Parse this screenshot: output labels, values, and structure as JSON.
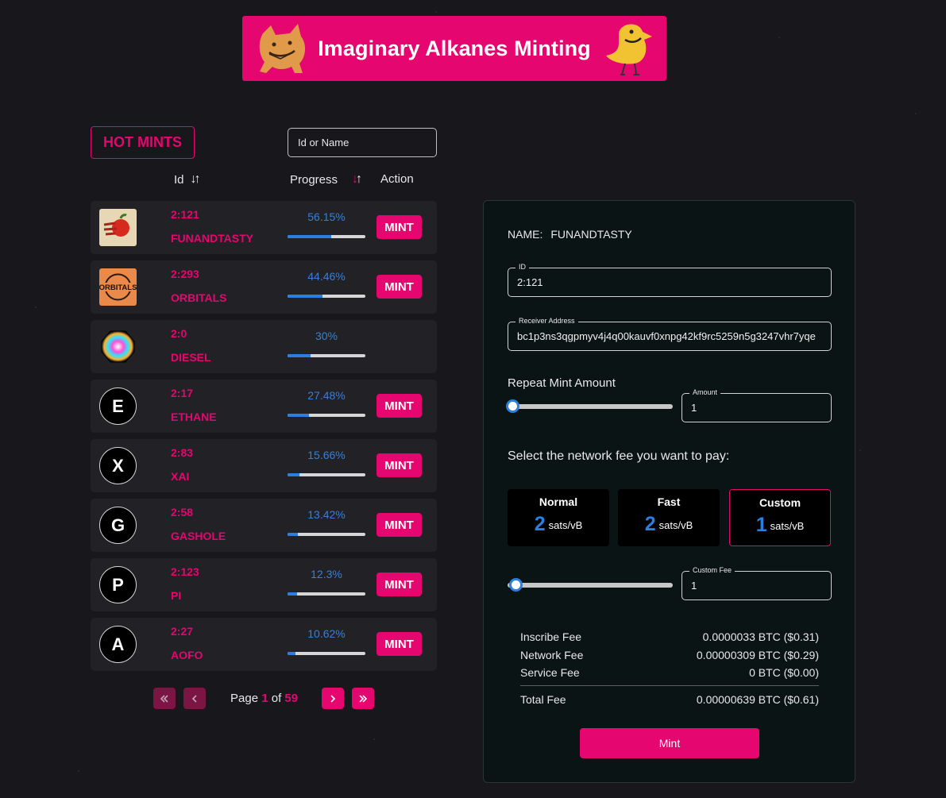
{
  "banner": {
    "title": "Imaginary Alkanes Minting"
  },
  "list": {
    "heading": "HOT MINTS",
    "search_placeholder": "Id or Name",
    "columns": {
      "id": "Id",
      "progress": "Progress",
      "action": "Action"
    },
    "rows": [
      {
        "id": "2:121",
        "name": "FUNANDTASTY",
        "progress_label": "56.15%",
        "progress": 56.15,
        "logo": "funandtasty-logo",
        "action": "MINT"
      },
      {
        "id": "2:293",
        "name": "ORBITALS",
        "progress_label": "44.46%",
        "progress": 44.46,
        "logo": "orbitals-logo",
        "logo_text": "ORBITALS",
        "action": "MINT"
      },
      {
        "id": "2:0",
        "name": "DIESEL",
        "progress_label": "30%",
        "progress": 30,
        "logo": "diesel-logo",
        "action": ""
      },
      {
        "id": "2:17",
        "name": "ETHANE",
        "progress_label": "27.48%",
        "progress": 27.48,
        "logo_letter": "E",
        "action": "MINT"
      },
      {
        "id": "2:83",
        "name": "XAI",
        "progress_label": "15.66%",
        "progress": 15.66,
        "logo_letter": "X",
        "action": "MINT"
      },
      {
        "id": "2:58",
        "name": "GASHOLE",
        "progress_label": "13.42%",
        "progress": 13.42,
        "logo_letter": "G",
        "action": "MINT"
      },
      {
        "id": "2:123",
        "name": "PI",
        "progress_label": "12.3%",
        "progress": 12.3,
        "logo_letter": "P",
        "action": "MINT"
      },
      {
        "id": "2:27",
        "name": "AOFO",
        "progress_label": "10.62%",
        "progress": 10.62,
        "logo_letter": "A",
        "action": "MINT"
      }
    ]
  },
  "pagination": {
    "page_word": "Page",
    "current": "1",
    "of_word": "of",
    "total": "59"
  },
  "panel": {
    "name_label": "NAME:",
    "name_value": "FUNANDTASTY",
    "id_label": "ID",
    "id_value": "2:121",
    "receiver_label": "Receiver Address",
    "receiver_value": "bc1p3ns3qgpmyv4j4q00kauvf0xnpg42kf9rc5259n5g3247vhr7yqe",
    "repeat_label": "Repeat Mint Amount",
    "amount_label": "Amount",
    "amount_value": "1",
    "fee_prompt": "Select the network fee you want to pay:",
    "fee_options": [
      {
        "title": "Normal",
        "value": "2",
        "unit": "sats/vB"
      },
      {
        "title": "Fast",
        "value": "2",
        "unit": "sats/vB"
      },
      {
        "title": "Custom",
        "value": "1",
        "unit": "sats/vB"
      }
    ],
    "custom_fee_label": "Custom Fee",
    "custom_fee_value": "1",
    "fees": [
      {
        "label": "Inscribe Fee",
        "value": "0.0000033 BTC ($0.31)"
      },
      {
        "label": "Network Fee",
        "value": "0.00000309 BTC ($0.29)"
      },
      {
        "label": "Service Fee",
        "value": "0 BTC ($0.00)"
      }
    ],
    "total": {
      "label": "Total Fee",
      "value": "0.00000639 BTC ($0.61)"
    },
    "mint_button": "Mint"
  },
  "colors": {
    "accent": "#e5066f",
    "progress": "#2a7fe0",
    "background": "#17171c",
    "panel": "#0b1414"
  }
}
